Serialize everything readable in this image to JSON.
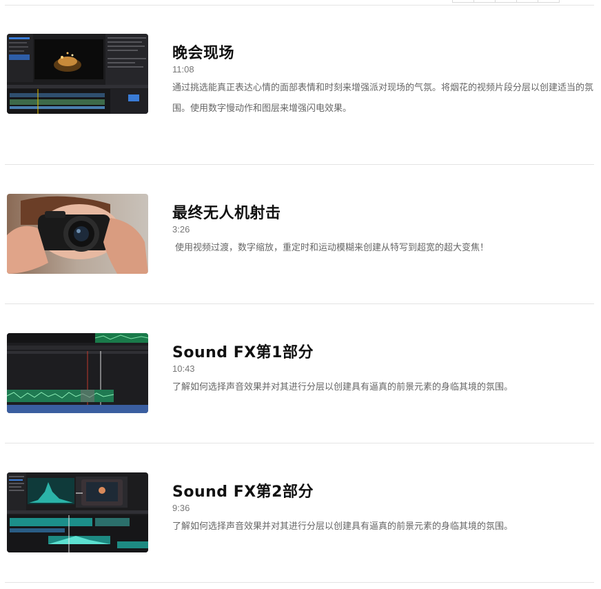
{
  "colors": {
    "title": "#111111",
    "duration": "#777777",
    "description": "#666666",
    "separator": "#e4e4e4"
  },
  "videos": [
    {
      "title": "晚会现场",
      "duration": "11:08",
      "description": "通过挑选能真正表达心情的面部表情和时刻来增强派对现场的气氛。将烟花的视频片段分层以创建适当的氛围。使用数字慢动作和图层来增强闪电效果。",
      "thumbnail_icon": "video-editor-thumbnail"
    },
    {
      "title": "最终无人机射击",
      "duration": "3:26",
      "description": "使用视频过渡，数字缩放，重定时和运动模糊来创建从特写到超宽的超大变焦！",
      "thumbnail_icon": "camera-photo-thumbnail"
    },
    {
      "title": "Sound FX第1部分",
      "duration": "10:43",
      "description": "了解如何选择声音效果并对其进行分层以创建具有逼真的前景元素的身临其境的氛围。",
      "thumbnail_icon": "audio-timeline-thumbnail"
    },
    {
      "title": "Sound FX第2部分",
      "duration": "9:36",
      "description": "了解如何选择声音效果并对其进行分层以创建具有逼真的前景元素的身临其境的氛围。",
      "thumbnail_icon": "video-editor-thumbnail"
    }
  ]
}
